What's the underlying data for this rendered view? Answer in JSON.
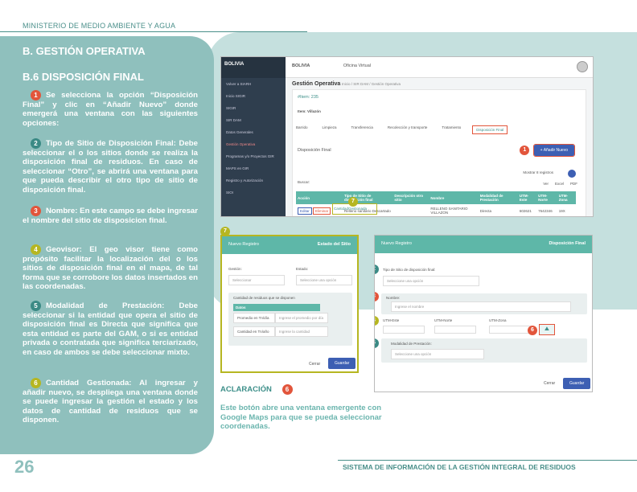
{
  "header": {
    "ministry": "MINISTERIO DE MEDIO AMBIENTE Y AGUA"
  },
  "section": {
    "title": "B. GESTIÓN OPERATIVA",
    "subtitle": "B.6 DISPOSICIÓN FINAL"
  },
  "steps": [
    {
      "n": "1",
      "text": "Se selecciona la opción “Disposición Final” y clic en “Añadir Nuevo” donde emergerá una ventana con las siguientes opciones:"
    },
    {
      "n": "2",
      "head": "Tipo de Sitio de Disposición Final:",
      "text": "Debe seleccionar el o los sitios donde se realiza la disposición final de residuos. En caso de seleccionar “Otro”, se abrirá una ventana para que pueda describir el otro tipo de sitio de disposición final."
    },
    {
      "n": "3",
      "head": "Nombre:",
      "text": "En este campo se debe ingresar el nombre del sitio de disposicion final."
    },
    {
      "n": "4",
      "head": "Geovisor:",
      "text": "El geo visor tiene como propósito facilitar la localización del o los sitios de disposición final en el mapa, de tal forma que se corrobore los datos insertados en las coordenadas."
    },
    {
      "n": "5",
      "head": "Modalidad de Prestación:",
      "text": "Debe seleccionar si la entidad que opera el sitio de disposición final es Directa que significa que esta entidad es parte del GAM, o si es entidad privada o contratada que significa terciarizado, en caso de ambos se debe seleccionar mixto."
    },
    {
      "n": "6",
      "head": "Cantidad Gestionada:",
      "text": "Al ingresar y añadir nuevo, se despliega una ventana donde se puede ingresar la gestión el estado y los datos de cantidad de residuos que se disponen."
    }
  ],
  "aclaracion": {
    "title": "ACLARACIÓN",
    "n": "6",
    "text": "Este botón abre una ventana emergente con Google Maps para que se pueda seleccionar coordenadas."
  },
  "footer": {
    "page": "26",
    "system": "SISTEMA DE INFORMACIÓN DE LA GESTIÓN INTEGRAL DE RESIDUOS"
  },
  "app": {
    "brand": "BOLIVIA",
    "office": "Oficina Virtual",
    "sidebar": [
      "Volver a SIARH",
      "Inicio SIGIR",
      "SIGIR",
      "SIR DAM",
      "Datos Generales",
      "Gestión Operativa",
      "Programas y/o Proyectos GIR",
      "MAPS en GIR",
      "Registro y Autorización",
      "SIOI"
    ],
    "page_title": "Gestión Operativa",
    "breadcrumb": "Inicio / SIR DAM / Gestión Operativa",
    "item_id": "#Item: 235",
    "item_name": "Item: Villazón",
    "tabs": [
      "Barrido",
      "Limpieza",
      "Transferencia",
      "Recolección y transporte",
      "Tratamiento",
      "Disposición Final"
    ],
    "card_title": "Disposición Final",
    "add_button": "+ Añadir Nuevo",
    "show_label": "Mostrar",
    "show_value": "8",
    "show_suffix": "registros",
    "search_label": "Buscar:",
    "view_buttons": [
      "Ver",
      "Excel",
      "PDF"
    ],
    "table_headers": [
      "Acción",
      "Tipo de Sitio de disposición final",
      "Descripción otro sitio",
      "Nombre",
      "Modalidad de Prestación",
      "UTM-Este",
      "UTM-Norte",
      "UTM-Zona"
    ],
    "row": {
      "edit": "Editar",
      "delete": "Eliminar",
      "qty": "CantidadGestionada",
      "tipo": "Relleno sanitario Descartado",
      "nombre": "RELLENO SANITARIO VILLAZON",
      "modalidad": "Directa",
      "este": "602621",
      "norte": "7642346",
      "zona": "19X"
    }
  },
  "modal_left": {
    "title": "Nuevo Registro",
    "right": "Estado del Sitio",
    "gestion_label": "Gestión:",
    "gestion_placeholder": "Seleccionar",
    "estado_label": "Estado:",
    "estado_placeholder": "Seleccione una opción",
    "qty_title": "Cantidad de residuos que se disponen",
    "datos": "Datos",
    "row1_label": "Promedio en Tn/día",
    "row1_ph": "Ingrese el promedio por día",
    "row2_label": "Cantidad en Tn/año",
    "row2_ph": "Ingrese la cantidad",
    "cancel": "Cerrar",
    "save": "Guardar"
  },
  "modal_right": {
    "title": "Nuevo Registro",
    "right": "Disposición Final",
    "tipo_label": "Tipo de Sitio de disposición final:",
    "tipo_ph": "Seleccione una opción",
    "nombre_label": "Nombre:",
    "nombre_ph": "Ingrese el nombre",
    "utm_e": "UTM-Este",
    "utm_n": "UTM-Norte",
    "utm_z": "UTM-Zona",
    "mod_label": "Modalidad de Prestación:",
    "mod_ph": "Seleccione una opción",
    "cancel": "Cerrar",
    "save": "Guardar"
  },
  "callouts": {
    "c1": "1",
    "c2": "2",
    "c3": "3",
    "c4": "4",
    "c5": "5",
    "c6": "6",
    "c7": "7"
  },
  "colors": {
    "teal_dark": "#3d8f89",
    "panel": "#8fc0bd",
    "accent_red": "#e2553b",
    "accent_yellow": "#b6b621",
    "header_teal": "#5eb7a8",
    "button_blue": "#3d5fb3"
  }
}
